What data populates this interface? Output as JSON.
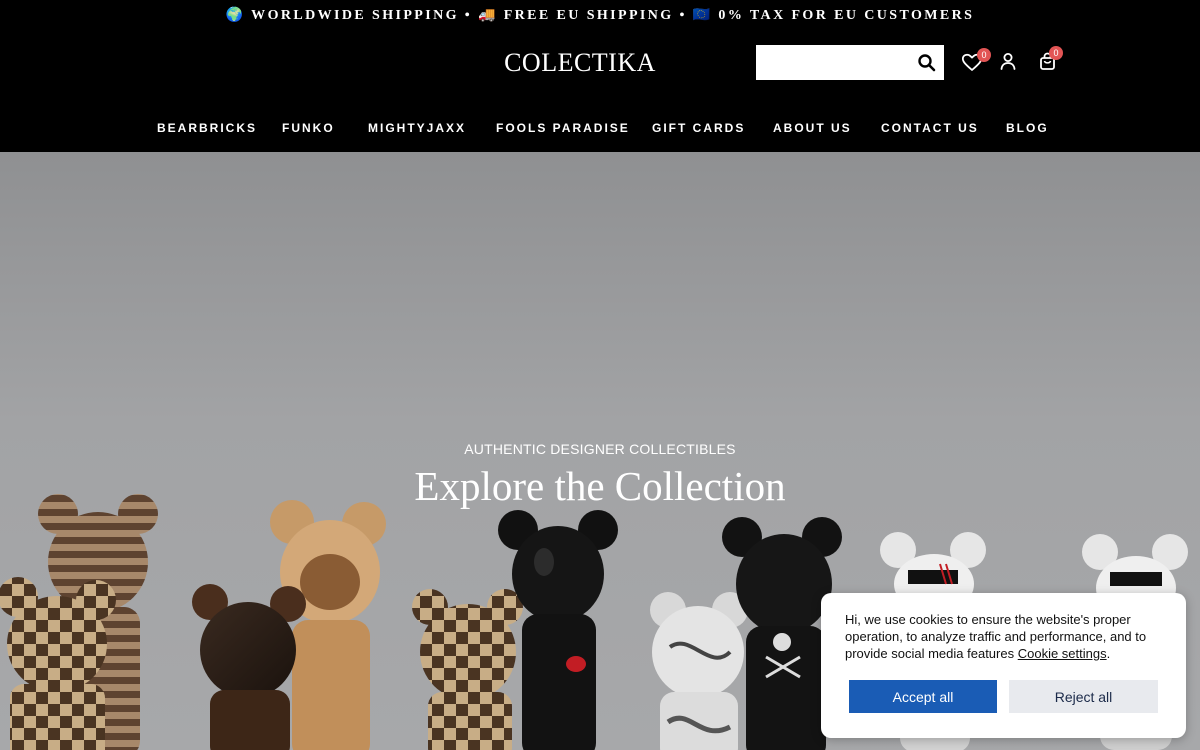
{
  "announcement": "🌍 WORLDWIDE SHIPPING • 🚚 FREE EU SHIPPING • 🇪🇺 0% TAX FOR EU CUSTOMERS",
  "brand": {
    "logo_text": "COLECTIKA"
  },
  "search": {
    "value": "",
    "placeholder": "",
    "icon": "search-icon"
  },
  "header_icons": {
    "wishlist": {
      "icon": "heart-icon",
      "count": "0"
    },
    "account": {
      "icon": "user-icon"
    },
    "cart": {
      "icon": "shopping-bag-icon",
      "count": "0"
    }
  },
  "nav": {
    "items": [
      {
        "label": "BEARBRICKS"
      },
      {
        "label": "FUNKO"
      },
      {
        "label": "MIGHTYJAXX"
      },
      {
        "label": "FOOLS PARADISE"
      },
      {
        "label": "GIFT CARDS"
      },
      {
        "label": "ABOUT US"
      },
      {
        "label": "CONTACT US"
      },
      {
        "label": "BLOG"
      }
    ]
  },
  "hero": {
    "kicker": "AUTHENTIC DESIGNER COLLECTIBLES",
    "title": "Explore the Collection"
  },
  "cookie_banner": {
    "text": "Hi, we use cookies to ensure the website's proper operation, to analyze traffic and performance, and to provide social media features",
    "link_label": "Cookie settings",
    "period": ".",
    "accept_label": "Accept all",
    "reject_label": "Reject all"
  },
  "colors": {
    "header_bg": "#000000",
    "accent_blue": "#1a5cb5",
    "badge_red": "#e25555",
    "reject_bg": "#e8eaee"
  }
}
